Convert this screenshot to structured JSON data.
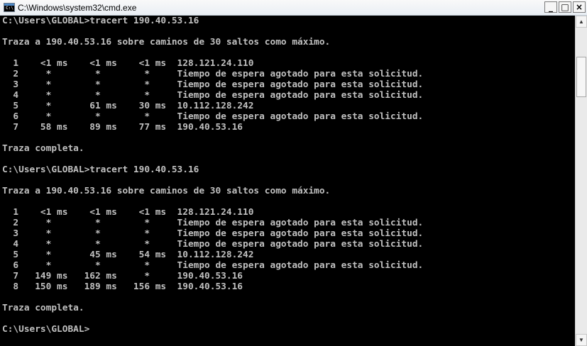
{
  "window": {
    "title": "C:\\Windows\\system32\\cmd.exe",
    "icon_text": "C:\\",
    "minimize_glyph": "_",
    "maximize_glyph": "□",
    "close_glyph": "×"
  },
  "scrollbar": {
    "up_glyph": "▲",
    "down_glyph": "▼"
  },
  "console": {
    "lines": [
      "C:\\Users\\GLOBAL>tracert 190.40.53.16",
      "",
      "Traza a 190.40.53.16 sobre caminos de 30 saltos como máximo.",
      "",
      "  1    <1 ms    <1 ms    <1 ms  128.121.24.110",
      "  2     *        *        *     Tiempo de espera agotado para esta solicitud.",
      "  3     *        *        *     Tiempo de espera agotado para esta solicitud.",
      "  4     *        *        *     Tiempo de espera agotado para esta solicitud.",
      "  5     *       61 ms    30 ms  10.112.128.242",
      "  6     *        *        *     Tiempo de espera agotado para esta solicitud.",
      "  7    58 ms    89 ms    77 ms  190.40.53.16",
      "",
      "Traza completa.",
      "",
      "C:\\Users\\GLOBAL>tracert 190.40.53.16",
      "",
      "Traza a 190.40.53.16 sobre caminos de 30 saltos como máximo.",
      "",
      "  1    <1 ms    <1 ms    <1 ms  128.121.24.110",
      "  2     *        *        *     Tiempo de espera agotado para esta solicitud.",
      "  3     *        *        *     Tiempo de espera agotado para esta solicitud.",
      "  4     *        *        *     Tiempo de espera agotado para esta solicitud.",
      "  5     *       45 ms    54 ms  10.112.128.242",
      "  6     *        *        *     Tiempo de espera agotado para esta solicitud.",
      "  7   149 ms   162 ms     *     190.40.53.16",
      "  8   150 ms   189 ms   156 ms  190.40.53.16",
      "",
      "Traza completa.",
      "",
      "C:\\Users\\GLOBAL>"
    ]
  }
}
